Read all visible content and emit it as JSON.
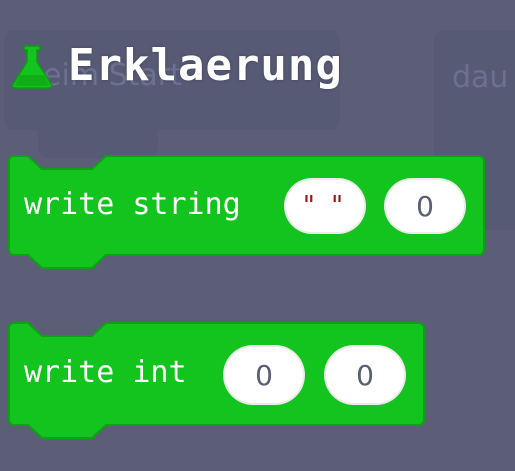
{
  "header": {
    "icon": "flask-icon",
    "title": "Erklaerung"
  },
  "background_blocks": {
    "left_label": "beim Start",
    "right_label": "dau"
  },
  "blocks": [
    {
      "label": "write string",
      "args": [
        "\" \"",
        "0"
      ]
    },
    {
      "label": "write int",
      "args": [
        "0",
        "0"
      ]
    }
  ],
  "colors": {
    "background": "#5c5e78",
    "block_green": "#14c41e",
    "block_border": "#0ea015",
    "flask_green": "#14c41e"
  }
}
